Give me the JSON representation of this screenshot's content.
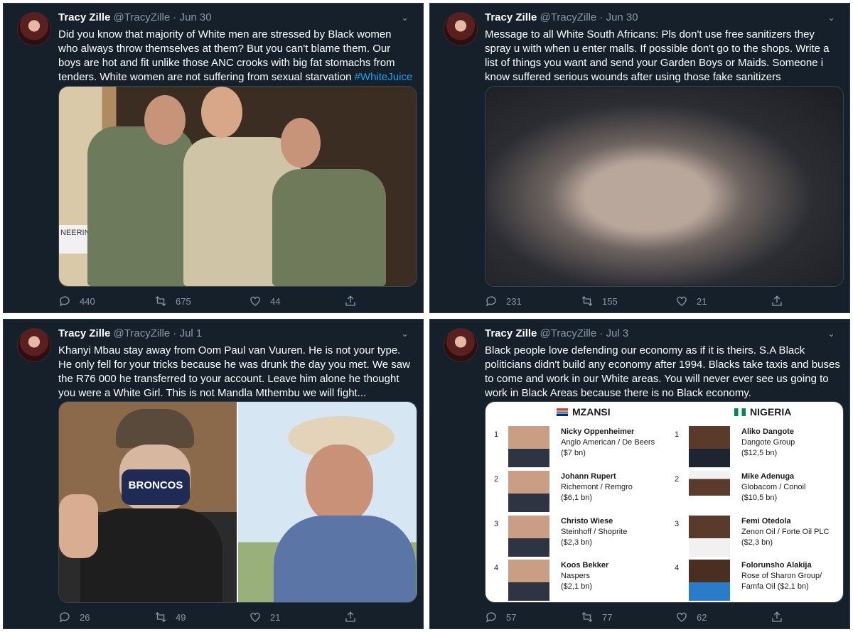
{
  "tweets": [
    {
      "name": "Tracy Zille",
      "handle": "@TracyZille",
      "date": "· Jun 30",
      "text": "Did you know that majority of White men are stressed by Black women who always throw themselves at them? But you can't blame them. Our boys are hot and fit unlike those ANC crooks with big fat stomachs from tenders. White women are not suffering from sexual starvation ",
      "hashtag": "#WhiteJuice",
      "replies": "440",
      "retweets": "675",
      "likes": "44",
      "media_sign": "NEERING"
    },
    {
      "name": "Tracy Zille",
      "handle": "@TracyZille",
      "date": "· Jun 30",
      "text": "Message to all White South Africans: Pls don't use free sanitizers they spray u with when u enter malls. If possible don't go to the shops. Write a list of things you want and send your Garden Boys or Maids. Someone i know suffered serious wounds after using those fake sanitizers",
      "replies": "231",
      "retweets": "155",
      "likes": "21"
    },
    {
      "name": "Tracy Zille",
      "handle": "@TracyZille",
      "date": "· Jul 1",
      "text": "Khanyi Mbau stay away from Oom Paul van Vuuren. He is not your type. He only fell for your tricks because he was drunk the day you met. We saw the R76 000 he transferred to your account. Leave him alone he thought you were a White Girl. This is not Mandla Mthembu we will fight...",
      "replies": "26",
      "retweets": "49",
      "likes": "21",
      "mask_text": "BRONCOS"
    },
    {
      "name": "Tracy Zille",
      "handle": "@TracyZille",
      "date": "· Jul 3",
      "text": "Black people love defending our economy as if it is theirs. S.A Black politicians didn't build any economy after 1994. Blacks take taxis and buses to come and work in our White areas. You will never ever see us going to work in Black Areas because there is no Black economy.",
      "replies": "57",
      "retweets": "77",
      "likes": "62"
    }
  ],
  "comparison": {
    "left_title": "MZANSI",
    "right_title": "NIGERIA",
    "left": [
      {
        "rank": "1",
        "name": "Nicky Oppenheimer",
        "company": "Anglo American / De Beers",
        "net": "($7 bn)"
      },
      {
        "rank": "2",
        "name": "Johann Rupert",
        "company": "Richemont / Remgro",
        "net": "($6,1 bn)"
      },
      {
        "rank": "3",
        "name": "Christo Wiese",
        "company": "Steinhoff / Shoprite",
        "net": "($2,3 bn)"
      },
      {
        "rank": "4",
        "name": "Koos Bekker",
        "company": "Naspers",
        "net": "($2,1 bn)"
      }
    ],
    "right": [
      {
        "rank": "1",
        "name": "Aliko Dangote",
        "company": "Dangote Group",
        "net": "($12,5 bn)"
      },
      {
        "rank": "2",
        "name": "Mike Adenuga",
        "company": "Globacom / Conoil",
        "net": "($10,5 bn)"
      },
      {
        "rank": "3",
        "name": "Femi Otedola",
        "company": "Zenon Oil / Forte Oil PLC",
        "net": "($2,3 bn)"
      },
      {
        "rank": "4",
        "name": "Folorunsho Alakija",
        "company": "Rose of Sharon Group/",
        "company2": "Famfa Oil ($2,1 bn)"
      }
    ]
  },
  "colors": {
    "background": "#15202b",
    "accent": "#1da1f2",
    "muted": "#8899a6"
  },
  "icons": [
    "reply-icon",
    "retweet-icon",
    "like-icon",
    "share-icon",
    "chevron-down-icon"
  ]
}
